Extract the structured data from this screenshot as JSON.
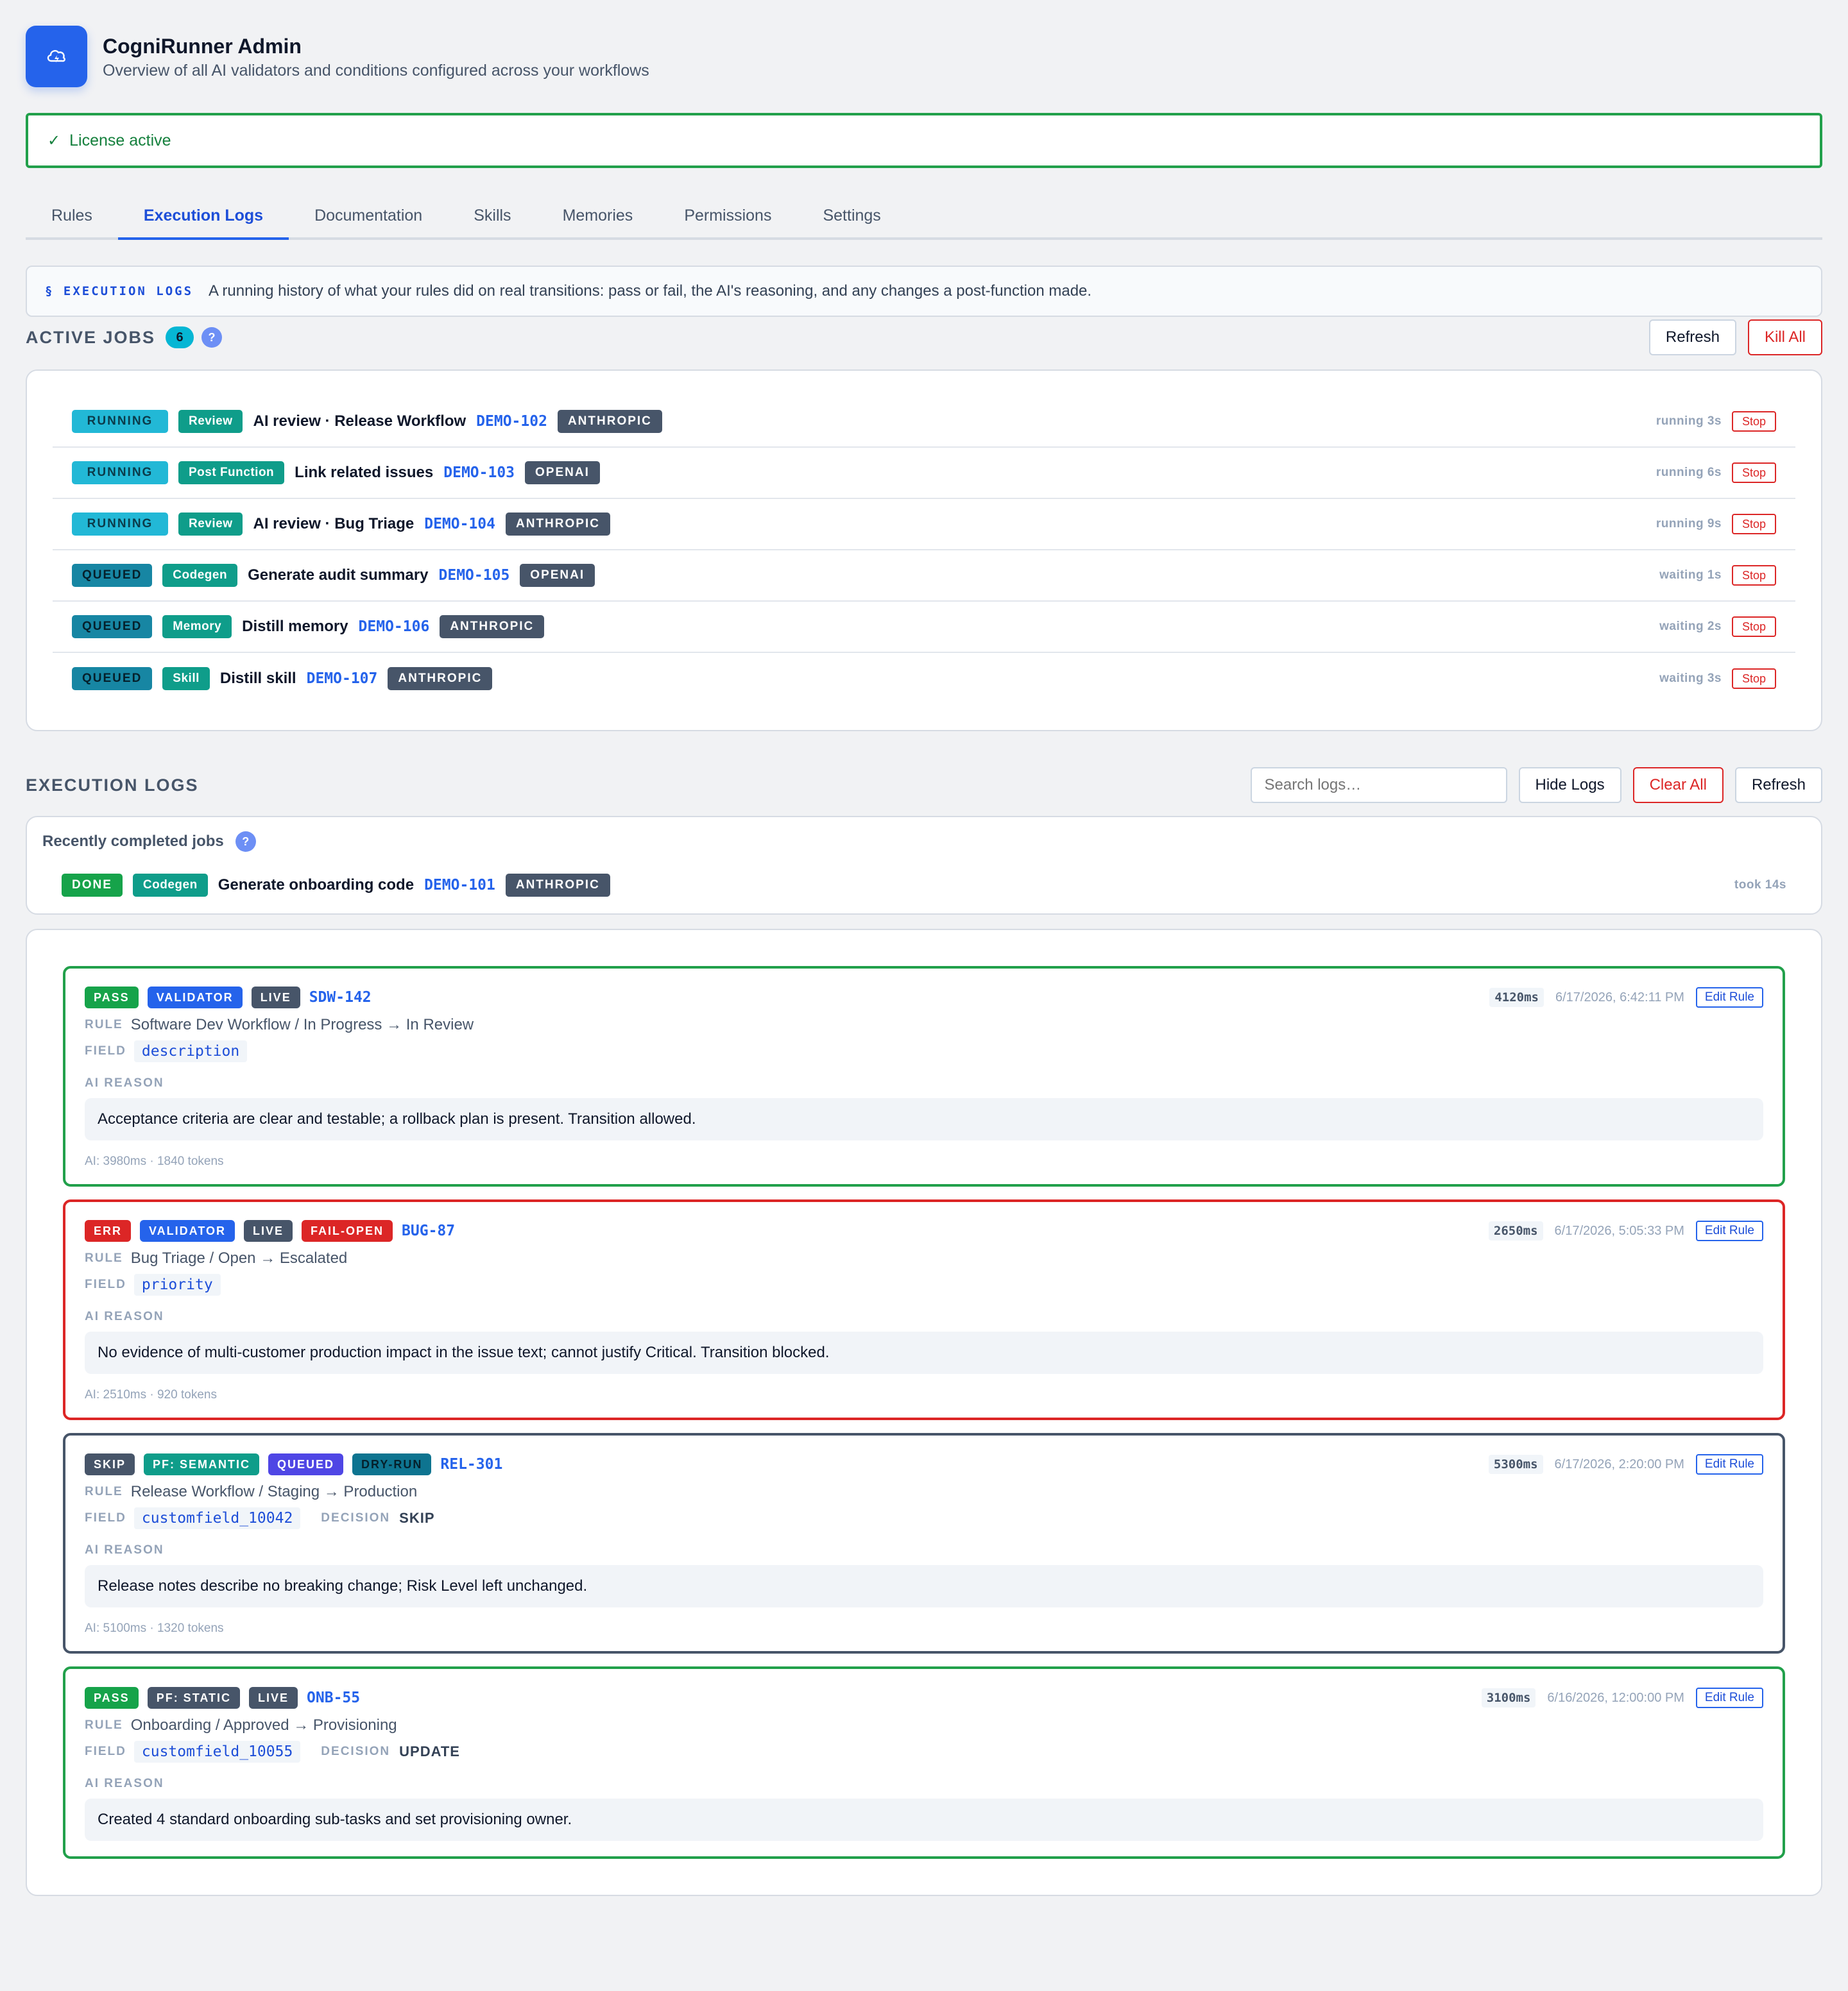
{
  "header": {
    "title": "CogniRunner Admin",
    "subtitle": "Overview of all AI validators and conditions configured across your workflows",
    "logo_icon": "cloud-lightning-icon"
  },
  "license": {
    "check": "✓",
    "text": "License active"
  },
  "tabs": [
    {
      "label": "Rules",
      "active": false
    },
    {
      "label": "Execution Logs",
      "active": true
    },
    {
      "label": "Documentation",
      "active": false
    },
    {
      "label": "Skills",
      "active": false
    },
    {
      "label": "Memories",
      "active": false
    },
    {
      "label": "Permissions",
      "active": false
    },
    {
      "label": "Settings",
      "active": false
    }
  ],
  "intro": {
    "kicker": "§ EXECUTION LOGS",
    "text": "A running history of what your rules did on real transitions: pass or fail, the AI's reasoning, and any changes a post-function made."
  },
  "active_jobs": {
    "title": "ACTIVE JOBS",
    "count": "6",
    "help": "?",
    "refresh_label": "Refresh",
    "kill_all_label": "Kill All",
    "jobs": [
      {
        "state": "RUNNING",
        "kind": "Review",
        "title": "AI review · Release Workflow",
        "key": "DEMO-102",
        "provider": "ANTHROPIC",
        "status": "running 3s",
        "stop": "Stop"
      },
      {
        "state": "RUNNING",
        "kind": "Post Function",
        "title": "Link related issues",
        "key": "DEMO-103",
        "provider": "OPENAI",
        "status": "running 6s",
        "stop": "Stop"
      },
      {
        "state": "RUNNING",
        "kind": "Review",
        "title": "AI review · Bug Triage",
        "key": "DEMO-104",
        "provider": "ANTHROPIC",
        "status": "running 9s",
        "stop": "Stop"
      },
      {
        "state": "QUEUED",
        "kind": "Codegen",
        "title": "Generate audit summary",
        "key": "DEMO-105",
        "provider": "OPENAI",
        "status": "waiting 1s",
        "stop": "Stop"
      },
      {
        "state": "QUEUED",
        "kind": "Memory",
        "title": "Distill memory",
        "key": "DEMO-106",
        "provider": "ANTHROPIC",
        "status": "waiting 2s",
        "stop": "Stop"
      },
      {
        "state": "QUEUED",
        "kind": "Skill",
        "title": "Distill skill",
        "key": "DEMO-107",
        "provider": "ANTHROPIC",
        "status": "waiting 3s",
        "stop": "Stop"
      }
    ]
  },
  "execution_logs": {
    "title": "EXECUTION LOGS",
    "search_placeholder": "Search logs…",
    "hide_label": "Hide Logs",
    "clear_label": "Clear All",
    "refresh_label": "Refresh",
    "recent": {
      "title": "Recently completed jobs",
      "help": "?",
      "job": {
        "state": "DONE",
        "kind": "Codegen",
        "title": "Generate onboarding code",
        "key": "DEMO-101",
        "provider": "ANTHROPIC",
        "status": "took 14s"
      }
    },
    "labels": {
      "rule": "RULE",
      "field": "FIELD",
      "decision": "DECISION",
      "ai_reason": "AI REASON",
      "edit": "Edit Rule"
    },
    "entries": [
      {
        "variant": "pass",
        "badges": [
          {
            "text": "PASS",
            "style": "pass"
          },
          {
            "text": "VALIDATOR",
            "style": "validator"
          },
          {
            "text": "LIVE",
            "style": "live"
          }
        ],
        "key": "SDW-142",
        "duration": "4120ms",
        "timestamp": "6/17/2026, 6:42:11 PM",
        "rule": "Software Dev Workflow / In Progress → In Review",
        "field": "description",
        "decision": "",
        "reason": "Acceptance criteria are clear and testable; a rollback plan is present. Transition allowed.",
        "ai_stats": "AI: 3980ms · 1840 tokens"
      },
      {
        "variant": "err",
        "badges": [
          {
            "text": "ERR",
            "style": "err"
          },
          {
            "text": "VALIDATOR",
            "style": "validator"
          },
          {
            "text": "LIVE",
            "style": "live"
          },
          {
            "text": "FAIL-OPEN",
            "style": "failopen"
          }
        ],
        "key": "BUG-87",
        "duration": "2650ms",
        "timestamp": "6/17/2026, 5:05:33 PM",
        "rule": "Bug Triage / Open → Escalated",
        "field": "priority",
        "decision": "",
        "reason": "No evidence of multi-customer production impact in the issue text; cannot justify Critical. Transition blocked.",
        "ai_stats": "AI: 2510ms · 920 tokens"
      },
      {
        "variant": "skip",
        "badges": [
          {
            "text": "SKIP",
            "style": "skip"
          },
          {
            "text": "PF: SEMANTIC",
            "style": "pf"
          },
          {
            "text": "QUEUED",
            "style": "queued"
          },
          {
            "text": "DRY-RUN",
            "style": "dryrun"
          }
        ],
        "key": "REL-301",
        "duration": "5300ms",
        "timestamp": "6/17/2026, 2:20:00 PM",
        "rule": "Release Workflow / Staging → Production",
        "field": "customfield_10042",
        "decision": "SKIP",
        "reason": "Release notes describe no breaking change; Risk Level left unchanged.",
        "ai_stats": "AI: 5100ms · 1320 tokens"
      },
      {
        "variant": "pass",
        "badges": [
          {
            "text": "PASS",
            "style": "pass"
          },
          {
            "text": "PF: STATIC",
            "style": "pfstatic"
          },
          {
            "text": "LIVE",
            "style": "live"
          }
        ],
        "key": "ONB-55",
        "duration": "3100ms",
        "timestamp": "6/16/2026, 12:00:00 PM",
        "rule": "Onboarding / Approved → Provisioning",
        "field": "customfield_10055",
        "decision": "UPDATE",
        "reason": "Created 4 standard onboarding sub-tasks and set provisioning owner.",
        "ai_stats": ""
      }
    ]
  }
}
